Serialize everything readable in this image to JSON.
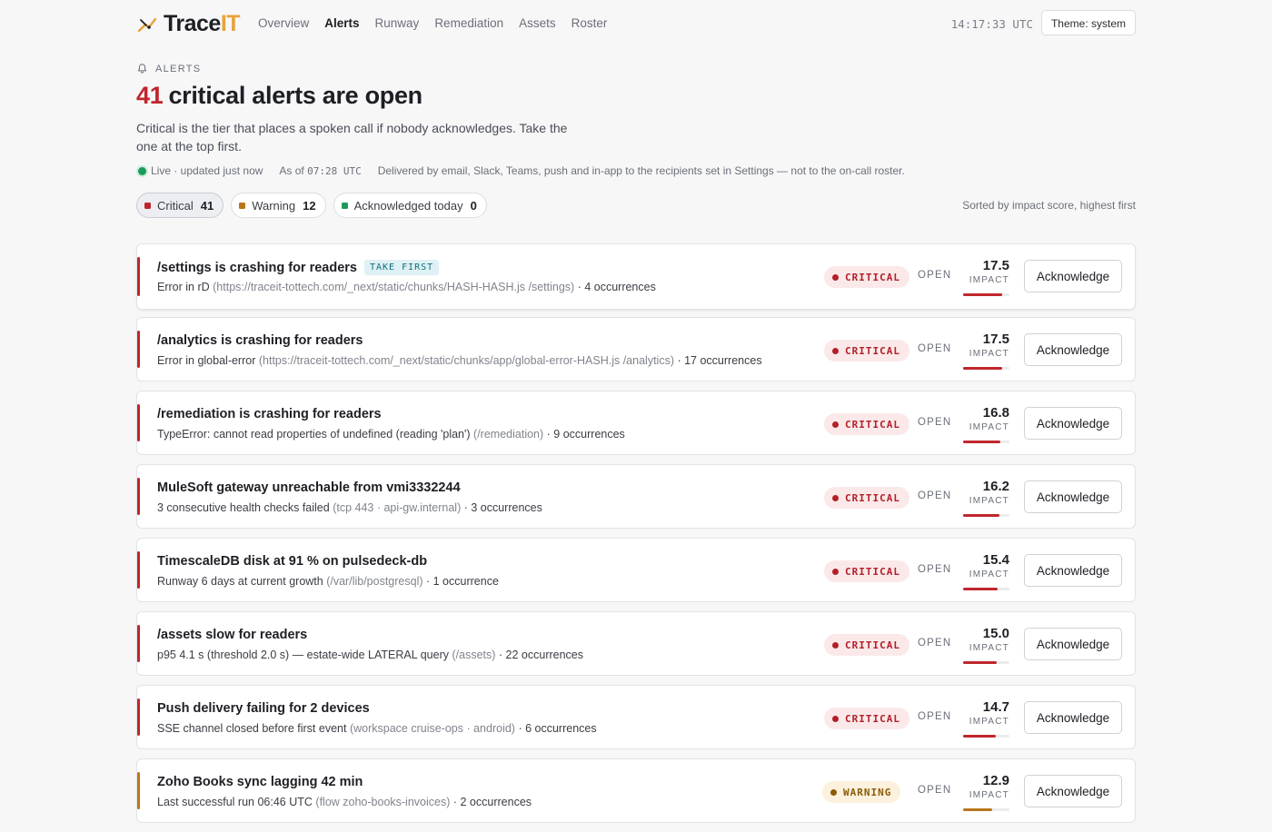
{
  "app": {
    "brand": "Trace",
    "brand_highlight": "IT",
    "nav": [
      {
        "label": "Overview",
        "active": false
      },
      {
        "label": "Alerts",
        "active": true
      },
      {
        "label": "Runway",
        "active": false
      },
      {
        "label": "Remediation",
        "active": false
      },
      {
        "label": "Assets",
        "active": false
      },
      {
        "label": "Roster",
        "active": false
      }
    ],
    "clock": "14:17:33 UTC",
    "theme_button": "Theme: system"
  },
  "header": {
    "eyebrow": "ALERTS",
    "open_count": "41",
    "title_rest": "critical alerts are open",
    "lede": "Critical is the tier that places a spoken call if nobody acknowledges. Take the one at the top first.",
    "live_text": "Live · updated  just now",
    "as_of_label": "As of ",
    "as_of_time": "07:28 UTC",
    "delivery_note": "Delivered by email, Slack, Teams, push and in-app to the recipients set in Settings — not to the on-call roster."
  },
  "filters": [
    {
      "label": "Critical",
      "count": "41",
      "color": "#c0262d",
      "active": true
    },
    {
      "label": "Warning",
      "count": "12",
      "color": "#b8761a",
      "active": false
    },
    {
      "label": "Acknowledged today",
      "count": "0",
      "color": "#1c9a5b",
      "active": false
    }
  ],
  "sort_note": "Sorted by impact score, highest first",
  "colors": {
    "critical": "#c0262d",
    "warning": "#b8761a",
    "ok": "#1c9a5b"
  },
  "alerts": [
    {
      "title": "/settings is crashing for readers",
      "badge": "TAKE FIRST",
      "detail_main": "Error in rD",
      "detail_context": "(https://traceit-tottech.com/_next/static/chunks/HASH-HASH.js /settings)",
      "occurrences": "· 4 occurrences",
      "severity": "critical",
      "severity_label": "CRITICAL",
      "status": "OPEN",
      "impact": "17.5",
      "impact_label": "IMPACT",
      "impact_fraction": 0.84,
      "action": "Acknowledge"
    },
    {
      "title": "/analytics is crashing for readers",
      "badge": "",
      "detail_main": "Error in global-error",
      "detail_context": "(https://traceit-tottech.com/_next/static/chunks/app/global-error-HASH.js /analytics)",
      "occurrences": "· 17 occurrences",
      "severity": "critical",
      "severity_label": "CRITICAL",
      "status": "OPEN",
      "impact": "17.5",
      "impact_label": "IMPACT",
      "impact_fraction": 0.84,
      "action": "Acknowledge"
    },
    {
      "title": "/remediation is crashing for readers",
      "badge": "",
      "detail_main": "TypeError: cannot read properties of undefined (reading 'plan')",
      "detail_context": "(/remediation)",
      "occurrences": "· 9 occurrences",
      "severity": "critical",
      "severity_label": "CRITICAL",
      "status": "OPEN",
      "impact": "16.8",
      "impact_label": "IMPACT",
      "impact_fraction": 0.81,
      "action": "Acknowledge"
    },
    {
      "title": "MuleSoft gateway unreachable from vmi3332244",
      "badge": "",
      "detail_main": "3 consecutive health checks failed",
      "detail_context": "(tcp 443 · api-gw.internal)",
      "occurrences": "· 3 occurrences",
      "severity": "critical",
      "severity_label": "CRITICAL",
      "status": "OPEN",
      "impact": "16.2",
      "impact_label": "IMPACT",
      "impact_fraction": 0.78,
      "action": "Acknowledge"
    },
    {
      "title": "TimescaleDB disk at 91 % on pulsedeck-db",
      "badge": "",
      "detail_main": "Runway 6 days at current growth",
      "detail_context": "(/var/lib/postgresql)",
      "occurrences": "· 1 occurrence",
      "severity": "critical",
      "severity_label": "CRITICAL",
      "status": "OPEN",
      "impact": "15.4",
      "impact_label": "IMPACT",
      "impact_fraction": 0.74,
      "action": "Acknowledge"
    },
    {
      "title": "/assets slow for readers",
      "badge": "",
      "detail_main": "p95 4.1 s (threshold 2.0 s) — estate-wide LATERAL query",
      "detail_context": "(/assets)",
      "occurrences": "· 22 occurrences",
      "severity": "critical",
      "severity_label": "CRITICAL",
      "status": "OPEN",
      "impact": "15.0",
      "impact_label": "IMPACT",
      "impact_fraction": 0.72,
      "action": "Acknowledge"
    },
    {
      "title": "Push delivery failing for 2 devices",
      "badge": "",
      "detail_main": "SSE channel closed before first event",
      "detail_context": "(workspace cruise-ops · android)",
      "occurrences": "· 6 occurrences",
      "severity": "critical",
      "severity_label": "CRITICAL",
      "status": "OPEN",
      "impact": "14.7",
      "impact_label": "IMPACT",
      "impact_fraction": 0.71,
      "action": "Acknowledge"
    },
    {
      "title": "Zoho Books sync lagging 42 min",
      "badge": "",
      "detail_main": "Last successful run 06:46 UTC",
      "detail_context": "(flow zoho-books-invoices)",
      "occurrences": "· 2 occurrences",
      "severity": "warning",
      "severity_label": "WARNING",
      "status": "OPEN",
      "impact": "12.9",
      "impact_label": "IMPACT",
      "impact_fraction": 0.62,
      "action": "Acknowledge"
    }
  ]
}
